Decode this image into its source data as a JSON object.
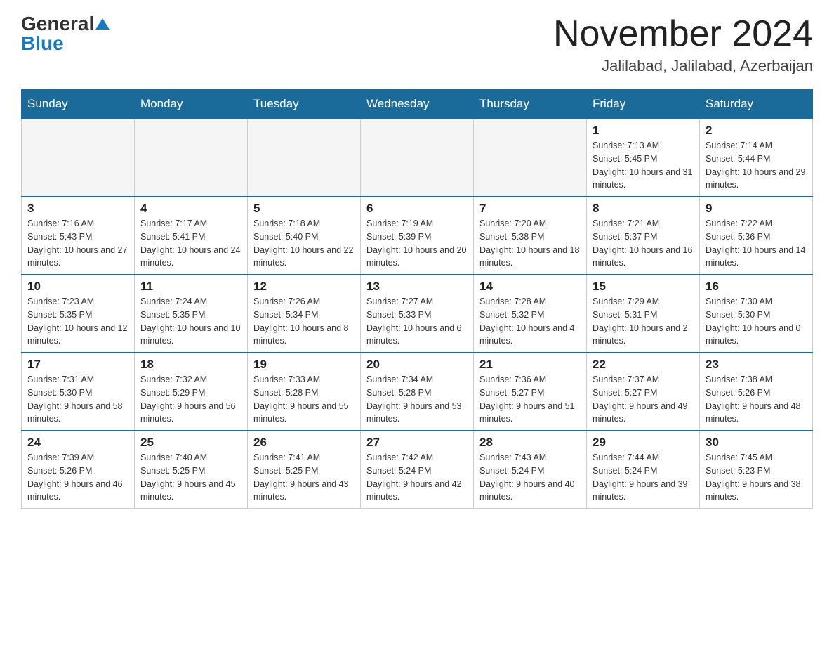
{
  "header": {
    "logo_general": "General",
    "logo_blue": "Blue",
    "month_title": "November 2024",
    "location": "Jalilabad, Jalilabad, Azerbaijan"
  },
  "days_of_week": [
    "Sunday",
    "Monday",
    "Tuesday",
    "Wednesday",
    "Thursday",
    "Friday",
    "Saturday"
  ],
  "weeks": [
    [
      {
        "day": "",
        "info": ""
      },
      {
        "day": "",
        "info": ""
      },
      {
        "day": "",
        "info": ""
      },
      {
        "day": "",
        "info": ""
      },
      {
        "day": "",
        "info": ""
      },
      {
        "day": "1",
        "info": "Sunrise: 7:13 AM\nSunset: 5:45 PM\nDaylight: 10 hours and 31 minutes."
      },
      {
        "day": "2",
        "info": "Sunrise: 7:14 AM\nSunset: 5:44 PM\nDaylight: 10 hours and 29 minutes."
      }
    ],
    [
      {
        "day": "3",
        "info": "Sunrise: 7:16 AM\nSunset: 5:43 PM\nDaylight: 10 hours and 27 minutes."
      },
      {
        "day": "4",
        "info": "Sunrise: 7:17 AM\nSunset: 5:41 PM\nDaylight: 10 hours and 24 minutes."
      },
      {
        "day": "5",
        "info": "Sunrise: 7:18 AM\nSunset: 5:40 PM\nDaylight: 10 hours and 22 minutes."
      },
      {
        "day": "6",
        "info": "Sunrise: 7:19 AM\nSunset: 5:39 PM\nDaylight: 10 hours and 20 minutes."
      },
      {
        "day": "7",
        "info": "Sunrise: 7:20 AM\nSunset: 5:38 PM\nDaylight: 10 hours and 18 minutes."
      },
      {
        "day": "8",
        "info": "Sunrise: 7:21 AM\nSunset: 5:37 PM\nDaylight: 10 hours and 16 minutes."
      },
      {
        "day": "9",
        "info": "Sunrise: 7:22 AM\nSunset: 5:36 PM\nDaylight: 10 hours and 14 minutes."
      }
    ],
    [
      {
        "day": "10",
        "info": "Sunrise: 7:23 AM\nSunset: 5:35 PM\nDaylight: 10 hours and 12 minutes."
      },
      {
        "day": "11",
        "info": "Sunrise: 7:24 AM\nSunset: 5:35 PM\nDaylight: 10 hours and 10 minutes."
      },
      {
        "day": "12",
        "info": "Sunrise: 7:26 AM\nSunset: 5:34 PM\nDaylight: 10 hours and 8 minutes."
      },
      {
        "day": "13",
        "info": "Sunrise: 7:27 AM\nSunset: 5:33 PM\nDaylight: 10 hours and 6 minutes."
      },
      {
        "day": "14",
        "info": "Sunrise: 7:28 AM\nSunset: 5:32 PM\nDaylight: 10 hours and 4 minutes."
      },
      {
        "day": "15",
        "info": "Sunrise: 7:29 AM\nSunset: 5:31 PM\nDaylight: 10 hours and 2 minutes."
      },
      {
        "day": "16",
        "info": "Sunrise: 7:30 AM\nSunset: 5:30 PM\nDaylight: 10 hours and 0 minutes."
      }
    ],
    [
      {
        "day": "17",
        "info": "Sunrise: 7:31 AM\nSunset: 5:30 PM\nDaylight: 9 hours and 58 minutes."
      },
      {
        "day": "18",
        "info": "Sunrise: 7:32 AM\nSunset: 5:29 PM\nDaylight: 9 hours and 56 minutes."
      },
      {
        "day": "19",
        "info": "Sunrise: 7:33 AM\nSunset: 5:28 PM\nDaylight: 9 hours and 55 minutes."
      },
      {
        "day": "20",
        "info": "Sunrise: 7:34 AM\nSunset: 5:28 PM\nDaylight: 9 hours and 53 minutes."
      },
      {
        "day": "21",
        "info": "Sunrise: 7:36 AM\nSunset: 5:27 PM\nDaylight: 9 hours and 51 minutes."
      },
      {
        "day": "22",
        "info": "Sunrise: 7:37 AM\nSunset: 5:27 PM\nDaylight: 9 hours and 49 minutes."
      },
      {
        "day": "23",
        "info": "Sunrise: 7:38 AM\nSunset: 5:26 PM\nDaylight: 9 hours and 48 minutes."
      }
    ],
    [
      {
        "day": "24",
        "info": "Sunrise: 7:39 AM\nSunset: 5:26 PM\nDaylight: 9 hours and 46 minutes."
      },
      {
        "day": "25",
        "info": "Sunrise: 7:40 AM\nSunset: 5:25 PM\nDaylight: 9 hours and 45 minutes."
      },
      {
        "day": "26",
        "info": "Sunrise: 7:41 AM\nSunset: 5:25 PM\nDaylight: 9 hours and 43 minutes."
      },
      {
        "day": "27",
        "info": "Sunrise: 7:42 AM\nSunset: 5:24 PM\nDaylight: 9 hours and 42 minutes."
      },
      {
        "day": "28",
        "info": "Sunrise: 7:43 AM\nSunset: 5:24 PM\nDaylight: 9 hours and 40 minutes."
      },
      {
        "day": "29",
        "info": "Sunrise: 7:44 AM\nSunset: 5:24 PM\nDaylight: 9 hours and 39 minutes."
      },
      {
        "day": "30",
        "info": "Sunrise: 7:45 AM\nSunset: 5:23 PM\nDaylight: 9 hours and 38 minutes."
      }
    ]
  ]
}
